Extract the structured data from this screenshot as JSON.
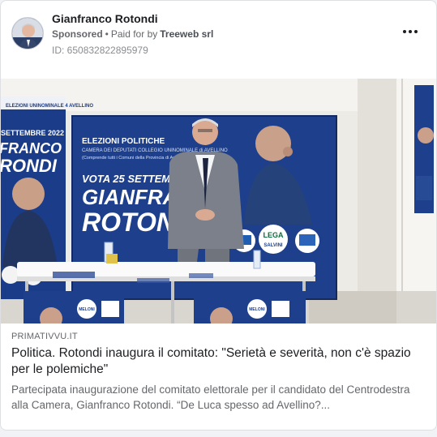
{
  "advertiser": {
    "name": "Gianfranco Rotondi",
    "sponsored_label": "Sponsored",
    "separator": "•",
    "paid_for_label": "Paid for by",
    "payer": "Treeweb srl",
    "ad_id": "ID: 650832822895979",
    "avatar_icon": "profile-photo-icon",
    "more_icon": "more-options-icon"
  },
  "banner": {
    "left_line1": "ELEZIONI UNINOMINALE 4 AVELLINO",
    "left_date": "SETTEMBRE 2022",
    "left_name1": "FRANCO",
    "left_name2": "RONDI",
    "main_heading": "ELEZIONI POLITICHE",
    "main_sub1": "CAMERA DEI DEPUTATI COLLEGIO UNINOMINALE di AVELLINO",
    "main_sub2": "(Comprende tutti i Comuni della Provincia di Avellino)",
    "vote_line": "VOTA  25 SETTEMBRE",
    "name1": "GIANFRANCO",
    "name2": "ROTONDI",
    "logo_lega": "LEGA",
    "logo_salvini": "SALVINI",
    "logo_meloni": "MELONI"
  },
  "preview": {
    "domain": "PRIMATIVVU.IT",
    "headline": "Politica. Rotondi inaugura il comitato: \"Serietà e severità, non c'è spazio per le polemiche\"",
    "description": "Partecipata inaugurazione del comitato elettorale per il candidato del Centrodestra alla Camera, Gianfranco Rotondi. “De Luca spesso ad Avellino?..."
  },
  "colors": {
    "banner_blue": "#1d3f8c",
    "banner_dark": "#17306d",
    "wall": "#e9e7e2",
    "text_primary": "#1c1e21",
    "text_secondary": "#65676b"
  }
}
